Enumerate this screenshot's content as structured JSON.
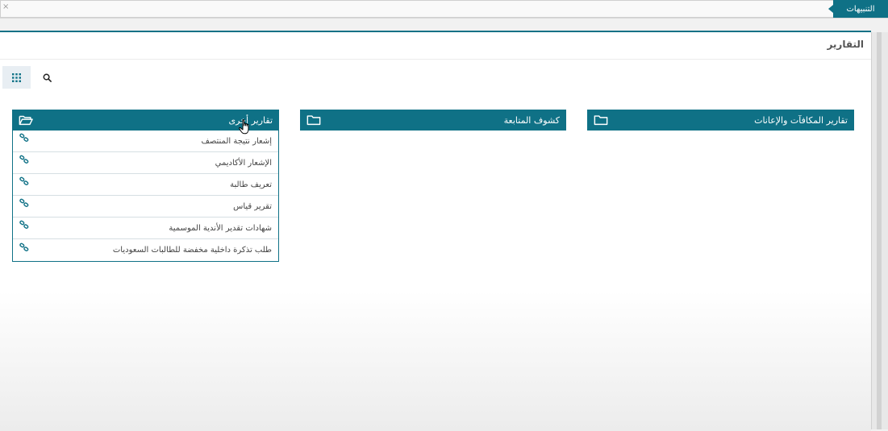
{
  "topbar": {
    "alerts_label": "التنبيهات",
    "close_glyph": "×"
  },
  "page": {
    "title": "التقارير"
  },
  "toolbar": {
    "grid_icon": "grid-icon",
    "search_icon": "search-icon"
  },
  "colors": {
    "accent": "#0f7186",
    "panel_bg": "#ffffff",
    "row_border": "#d6dfe3"
  },
  "cards": [
    {
      "title": "تقارير أخرى",
      "icon": "folder-open-icon",
      "items": [
        {
          "label": "إشعار نتيجة المنتصف"
        },
        {
          "label": "الإشعار الأكاديمي"
        },
        {
          "label": "تعريف طالبة"
        },
        {
          "label": "تقرير قياس"
        },
        {
          "label": "شهادات تقدير الأندية الموسمية"
        },
        {
          "label": "طلب تذكرة داخلية مخفضة للطالبات السعوديات"
        }
      ]
    },
    {
      "title": "كشوف المتابعة",
      "icon": "folder-icon",
      "items": []
    },
    {
      "title": "تقارير المكافآت والإعانات",
      "icon": "folder-icon",
      "items": []
    }
  ]
}
